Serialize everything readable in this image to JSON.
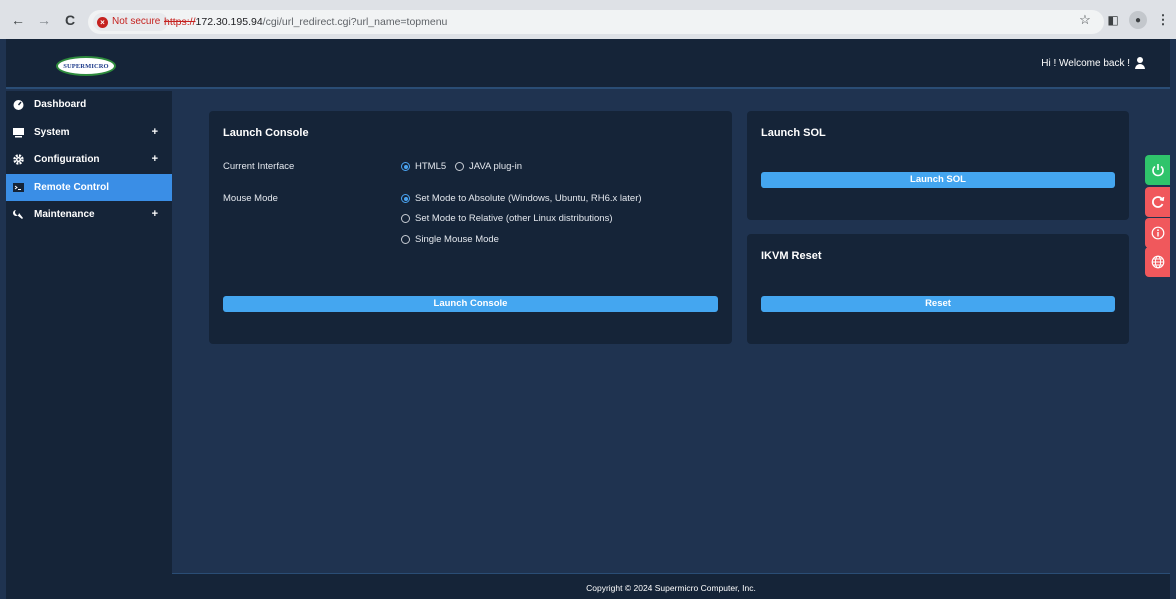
{
  "browser": {
    "security_label": "Not secure",
    "url_protocol": "https://",
    "url_host": "172.30.195.94",
    "url_path": "/cgi/url_redirect.cgi?url_name=topmenu"
  },
  "header": {
    "logo_text": "SUPERMICRO",
    "welcome_text": "Hi ! Welcome back !"
  },
  "sidebar": {
    "items": [
      {
        "label": "Dashboard",
        "icon": "dashboard-icon",
        "expandable": false,
        "active": false
      },
      {
        "label": "System",
        "icon": "monitor-icon",
        "expandable": true,
        "active": false
      },
      {
        "label": "Configuration",
        "icon": "gear-icon",
        "expandable": true,
        "active": false
      },
      {
        "label": "Remote Control",
        "icon": "terminal-icon",
        "expandable": false,
        "active": true
      },
      {
        "label": "Maintenance",
        "icon": "wrench-icon",
        "expandable": true,
        "active": false
      }
    ],
    "expand_symbol": "+"
  },
  "launch_console": {
    "title": "Launch Console",
    "interface_label": "Current Interface",
    "interface_options": [
      "HTML5",
      "JAVA plug-in"
    ],
    "mouse_label": "Mouse Mode",
    "mouse_options": [
      "Set Mode to Absolute (Windows, Ubuntu, RH6.x later)",
      "Set Mode to Relative (other Linux distributions)",
      "Single Mouse Mode"
    ],
    "button_label": "Launch Console"
  },
  "launch_sol": {
    "title": "Launch SOL",
    "button_label": "Launch SOL"
  },
  "ikvm_reset": {
    "title": "IKVM Reset",
    "button_label": "Reset"
  },
  "quick_tabs": [
    {
      "icon": "power-icon",
      "color": "#2fc46b"
    },
    {
      "icon": "refresh-icon",
      "color": "#f0585c"
    },
    {
      "icon": "info-icon",
      "color": "#f0585c"
    },
    {
      "icon": "globe-icon",
      "color": "#f0585c"
    }
  ],
  "footer": {
    "copyright": "Copyright © 2024 Supermicro Computer, Inc."
  }
}
